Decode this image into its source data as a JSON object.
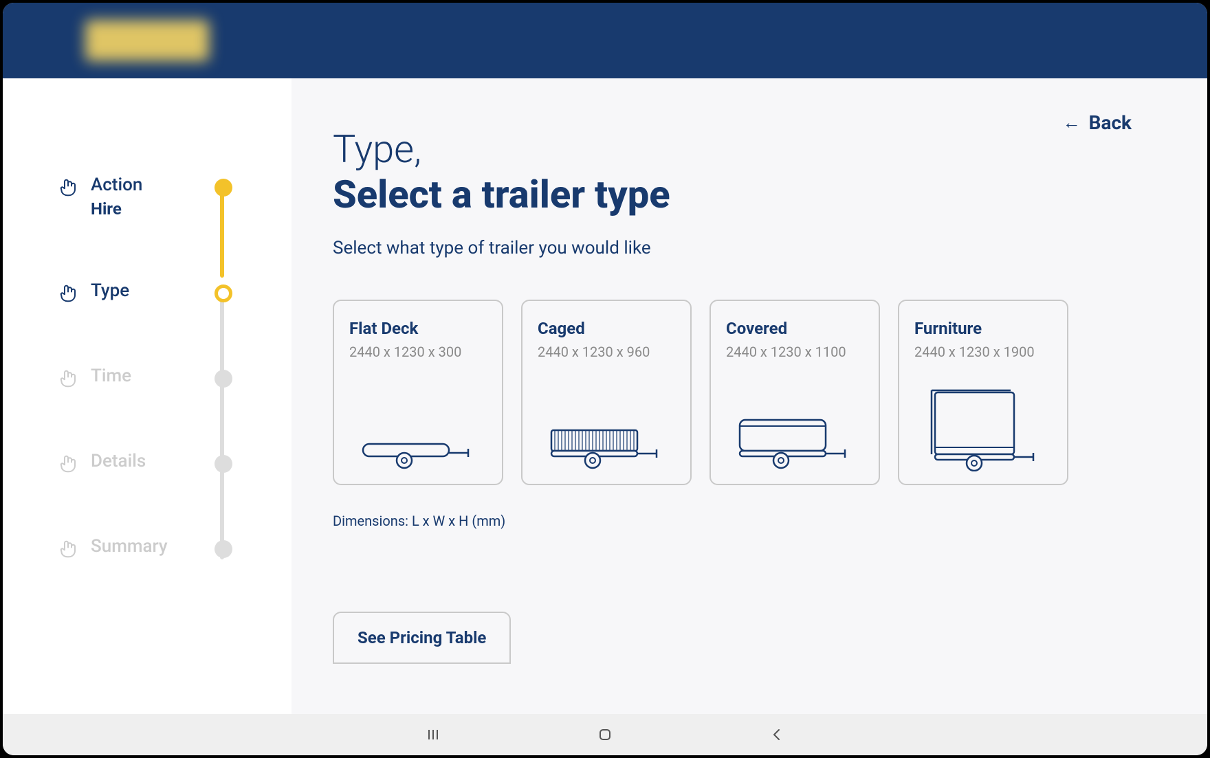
{
  "colors": {
    "brand": "#183a6e",
    "accent": "#f3c22a"
  },
  "back": {
    "label": "Back",
    "arrow": "←"
  },
  "title": {
    "prefix": "Type,",
    "main": "Select a trailer type"
  },
  "subtitle": "Select what type of trailer you would like",
  "dims_note": "Dimensions: L x W x H (mm)",
  "pricing_button": "See Pricing Table",
  "sidebar": {
    "steps": [
      {
        "label": "Action",
        "sub": "Hire",
        "state": "done"
      },
      {
        "label": "Type",
        "sub": "",
        "state": "current"
      },
      {
        "label": "Time",
        "sub": "",
        "state": "disabled"
      },
      {
        "label": "Details",
        "sub": "",
        "state": "disabled"
      },
      {
        "label": "Summary",
        "sub": "",
        "state": "disabled"
      }
    ]
  },
  "options": [
    {
      "name": "Flat Deck",
      "dims": "2440 x 1230 x 300",
      "icon": "flat-deck"
    },
    {
      "name": "Caged",
      "dims": "2440 x 1230 x 960",
      "icon": "caged"
    },
    {
      "name": "Covered",
      "dims": "2440 x 1230 x 1100",
      "icon": "covered"
    },
    {
      "name": "Furniture",
      "dims": "2440 x 1230 x 1900",
      "icon": "furniture"
    }
  ]
}
